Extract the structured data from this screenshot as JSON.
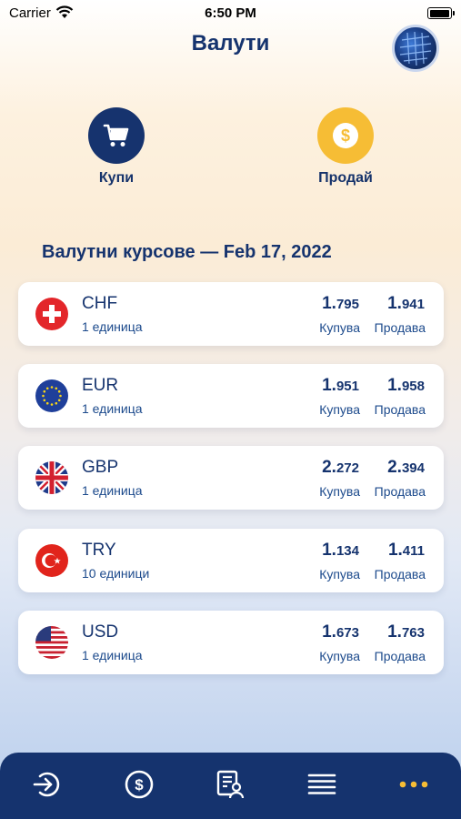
{
  "status_bar": {
    "carrier": "Carrier",
    "time": "6:50 PM"
  },
  "header": {
    "title": "Валути"
  },
  "actions": {
    "buy_label": "Купи",
    "sell_label": "Продай"
  },
  "section_title": "Валутни курсове — Feb 17, 2022",
  "rate_labels": {
    "buy": "Купува",
    "sell": "Продава"
  },
  "currencies": [
    {
      "code": "CHF",
      "unit": "1 единица",
      "buy_int": "1.",
      "buy_dec": "795",
      "sell_int": "1.",
      "sell_dec": "941"
    },
    {
      "code": "EUR",
      "unit": "1 единица",
      "buy_int": "1.",
      "buy_dec": "951",
      "sell_int": "1.",
      "sell_dec": "958"
    },
    {
      "code": "GBP",
      "unit": "1 единица",
      "buy_int": "2.",
      "buy_dec": "272",
      "sell_int": "2.",
      "sell_dec": "394"
    },
    {
      "code": "TRY",
      "unit": "10 единици",
      "buy_int": "1.",
      "buy_dec": "134",
      "sell_int": "1.",
      "sell_dec": "411"
    },
    {
      "code": "USD",
      "unit": "1 единица",
      "buy_int": "1.",
      "buy_dec": "673",
      "sell_int": "1.",
      "sell_dec": "763"
    }
  ],
  "tab_bar": {
    "icons": [
      "login-icon",
      "dollar-coin-icon",
      "document-person-icon",
      "list-icon",
      "more-dots-icon"
    ]
  },
  "colors": {
    "navy": "#15336e",
    "accent_yellow": "#f6bd35"
  }
}
